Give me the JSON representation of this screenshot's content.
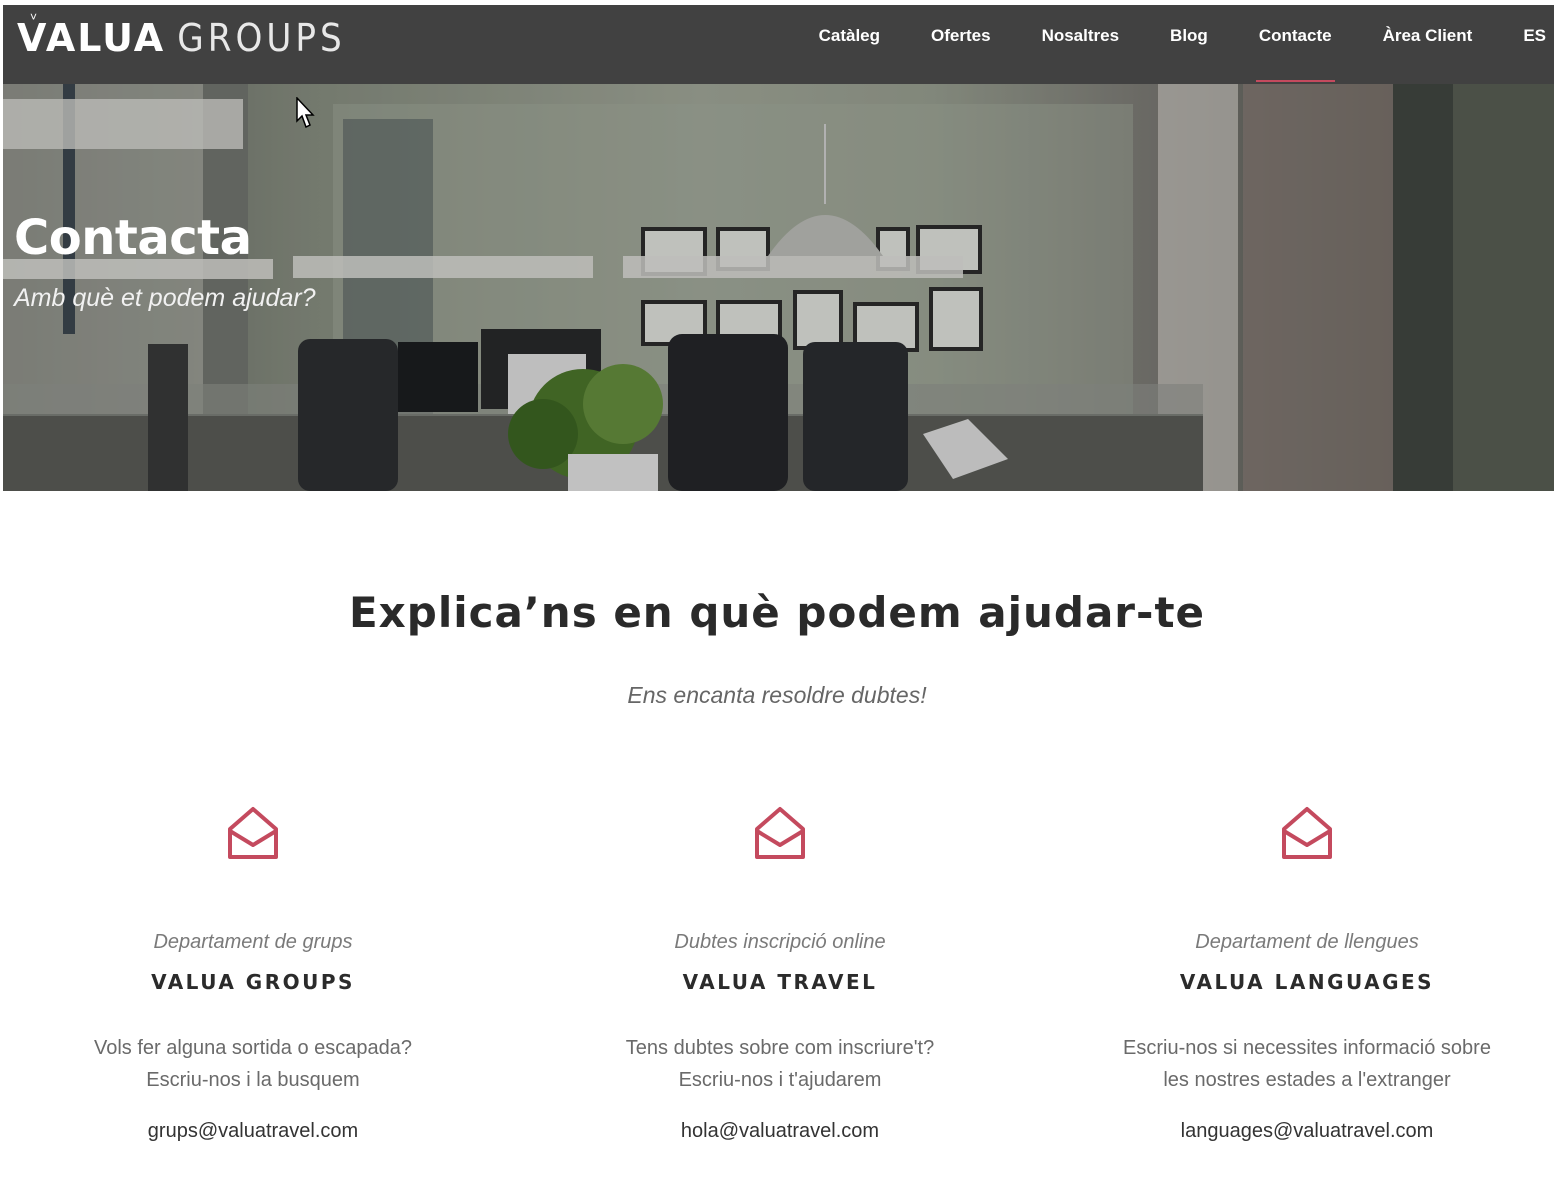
{
  "header": {
    "logo_primary": "VALUA",
    "logo_secondary": "GROUPS",
    "nav": [
      {
        "label": "Catàleg"
      },
      {
        "label": "Ofertes"
      },
      {
        "label": "Nosaltres"
      },
      {
        "label": "Blog"
      },
      {
        "label": "Contacte",
        "active": true
      },
      {
        "label": "Àrea Client"
      },
      {
        "label": "ES"
      }
    ]
  },
  "hero": {
    "title": "Contacta",
    "subtitle": "Amb què et podem ajudar?"
  },
  "main": {
    "title": "Explica’ns en què podem ajudar-te",
    "subtitle": "Ens encanta resoldre dubtes!"
  },
  "cards": [
    {
      "kicker": "Departament de grups",
      "name": "VALUA GROUPS",
      "desc_line1": "Vols fer alguna sortida o escapada?",
      "desc_line2": "Escriu-nos i la busquem",
      "email": "grups@valuatravel.com"
    },
    {
      "kicker": "Dubtes inscripció online",
      "name": "VALUA TRAVEL",
      "desc_line1": "Tens dubtes sobre com inscriure't?",
      "desc_line2": "Escriu-nos i t'ajudarem",
      "email": "hola@valuatravel.com"
    },
    {
      "kicker": "Departament de llengues",
      "name": "VALUA LANGUAGES",
      "desc_line1": "Escriu-nos si necessites informació sobre",
      "desc_line2": "les nostres  estades a l'extranger",
      "email": "languages@valuatravel.com"
    }
  ],
  "colors": {
    "header_bg": "#414141",
    "accent": "#c44a5e"
  },
  "icons": {
    "card_icon": "open-envelope-icon"
  }
}
